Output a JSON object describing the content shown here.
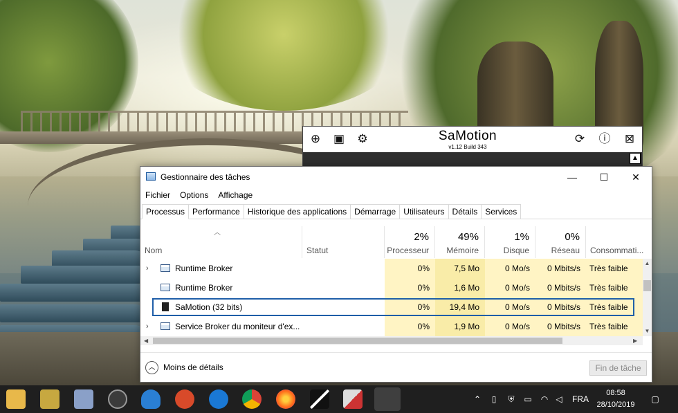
{
  "samotion": {
    "title": "SaMotion",
    "version": "v1.12 Build 343",
    "icons": [
      "add-circle-icon",
      "save-icon",
      "gear-icon",
      "refresh-icon",
      "info-icon",
      "close-box-icon"
    ]
  },
  "taskmanager": {
    "title": "Gestionnaire des tâches",
    "window_buttons": {
      "minimize": "—",
      "maximize": "☐",
      "close": "✕"
    },
    "menu": [
      "Fichier",
      "Options",
      "Affichage"
    ],
    "tabs": [
      "Processus",
      "Performance",
      "Historique des applications",
      "Démarrage",
      "Utilisateurs",
      "Détails",
      "Services"
    ],
    "active_tab": "Processus",
    "columns": {
      "name": "Nom",
      "status": "Statut",
      "cpu": {
        "pct": "2%",
        "label": "Processeur"
      },
      "memory": {
        "pct": "49%",
        "label": "Mémoire"
      },
      "disk": {
        "pct": "1%",
        "label": "Disque"
      },
      "network": {
        "pct": "0%",
        "label": "Réseau"
      },
      "power": {
        "label": "Consommati..."
      }
    },
    "rows": [
      {
        "name": "Runtime Broker",
        "cpu": "0%",
        "memory": "7,5 Mo",
        "disk": "0 Mo/s",
        "network": "0 Mbits/s",
        "power": "Très faible",
        "expandable": true,
        "selected": false
      },
      {
        "name": "Runtime Broker",
        "cpu": "0%",
        "memory": "1,6 Mo",
        "disk": "0 Mo/s",
        "network": "0 Mbits/s",
        "power": "Très faible",
        "expandable": false,
        "selected": false
      },
      {
        "name": "SaMotion (32 bits)",
        "cpu": "0%",
        "memory": "19,4 Mo",
        "disk": "0 Mo/s",
        "network": "0 Mbits/s",
        "power": "Très faible",
        "expandable": false,
        "selected": true
      },
      {
        "name": "Service Broker du moniteur d'ex...",
        "cpu": "0%",
        "memory": "1,9 Mo",
        "disk": "0 Mo/s",
        "network": "0 Mbits/s",
        "power": "Très faible",
        "expandable": true,
        "selected": false
      }
    ],
    "footer": {
      "less_details": "Moins de détails",
      "end_task": "Fin de tâche"
    }
  },
  "taskbar": {
    "pinned": [
      "file-explorer-icon",
      "app-icon",
      "network-app-icon",
      "camera-app-icon",
      "malwarebytes-icon",
      "ccleaner-icon",
      "edge-icon",
      "chrome-icon",
      "firefox-icon",
      "app-icon",
      "app-icon",
      "taskmanager-icon"
    ],
    "tray": {
      "language": "FRA",
      "time": "08:58",
      "date": "28/10/2019"
    }
  },
  "colors": {
    "highlight_light": "#fff4c4",
    "highlight_dark": "#f9eca8",
    "selection_border": "#1f5ea8",
    "taskbar": "#1f1f1f"
  }
}
